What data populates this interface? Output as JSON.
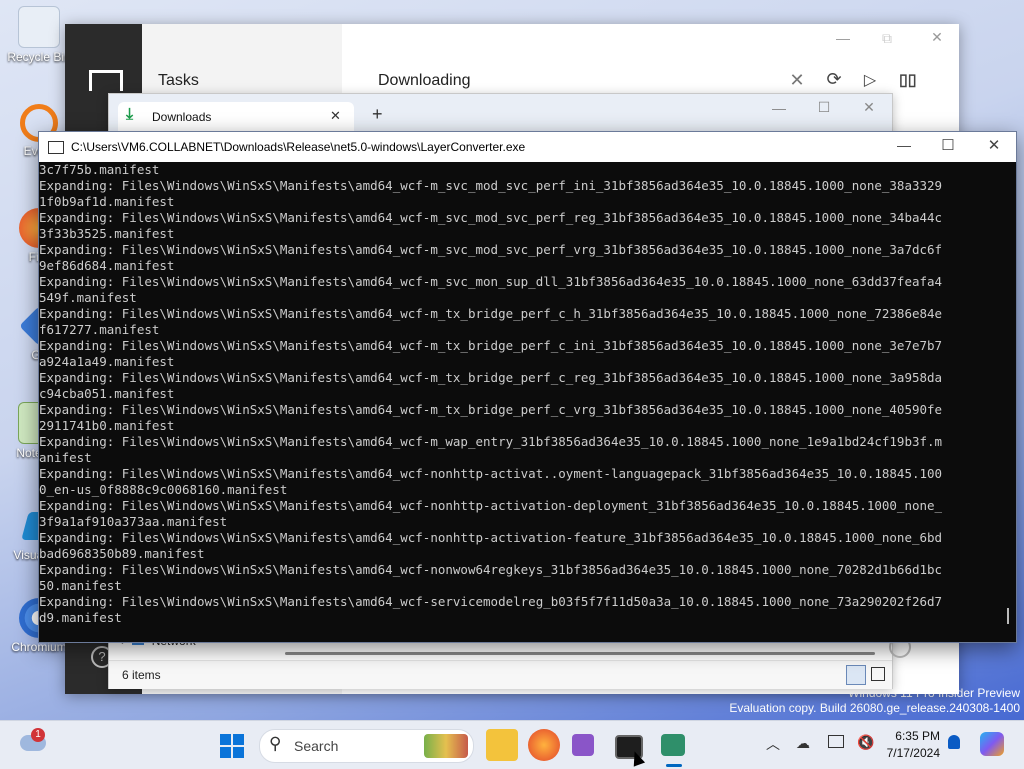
{
  "desktop": {
    "icons": [
      "Recycle Bin",
      "Every",
      "Fire",
      "Git",
      "Notepad",
      "Visual Co",
      "Chromium"
    ],
    "watermark": [
      "Windows 11 Pro Insider Preview",
      "Evaluation copy. Build 26080.ge_release.240308-1400"
    ]
  },
  "tasks_window": {
    "nav_title": "Tasks",
    "header": "Downloading"
  },
  "explorer": {
    "tab_label": "Downloads",
    "new_tab": "+",
    "nav_item": "Network",
    "status_items": "6 items"
  },
  "console": {
    "title": "C:\\Users\\VM6.COLLABNET\\Downloads\\Release\\net5.0-windows\\LayerConverter.exe",
    "lines": [
      "3c7f75b.manifest",
      "Expanding: Files\\Windows\\WinSxS\\Manifests\\amd64_wcf-m_svc_mod_svc_perf_ini_31bf3856ad364e35_10.0.18845.1000_none_38a3329",
      "1f0b9af1d.manifest",
      "Expanding: Files\\Windows\\WinSxS\\Manifests\\amd64_wcf-m_svc_mod_svc_perf_reg_31bf3856ad364e35_10.0.18845.1000_none_34ba44c",
      "3f33b3525.manifest",
      "Expanding: Files\\Windows\\WinSxS\\Manifests\\amd64_wcf-m_svc_mod_svc_perf_vrg_31bf3856ad364e35_10.0.18845.1000_none_3a7dc6f",
      "9ef86d684.manifest",
      "Expanding: Files\\Windows\\WinSxS\\Manifests\\amd64_wcf-m_svc_mon_sup_dll_31bf3856ad364e35_10.0.18845.1000_none_63dd37feafa4",
      "549f.manifest",
      "Expanding: Files\\Windows\\WinSxS\\Manifests\\amd64_wcf-m_tx_bridge_perf_c_h_31bf3856ad364e35_10.0.18845.1000_none_72386e84e",
      "f617277.manifest",
      "Expanding: Files\\Windows\\WinSxS\\Manifests\\amd64_wcf-m_tx_bridge_perf_c_ini_31bf3856ad364e35_10.0.18845.1000_none_3e7e7b7",
      "a924a1a49.manifest",
      "Expanding: Files\\Windows\\WinSxS\\Manifests\\amd64_wcf-m_tx_bridge_perf_c_reg_31bf3856ad364e35_10.0.18845.1000_none_3a958da",
      "c94cba051.manifest",
      "Expanding: Files\\Windows\\WinSxS\\Manifests\\amd64_wcf-m_tx_bridge_perf_c_vrg_31bf3856ad364e35_10.0.18845.1000_none_40590fe",
      "2911741b0.manifest",
      "Expanding: Files\\Windows\\WinSxS\\Manifests\\amd64_wcf-m_wap_entry_31bf3856ad364e35_10.0.18845.1000_none_1e9a1bd24cf19b3f.m",
      "anifest",
      "Expanding: Files\\Windows\\WinSxS\\Manifests\\amd64_wcf-nonhttp-activat..oyment-languagepack_31bf3856ad364e35_10.0.18845.100",
      "0_en-us_0f8888c9c0068160.manifest",
      "Expanding: Files\\Windows\\WinSxS\\Manifests\\amd64_wcf-nonhttp-activation-deployment_31bf3856ad364e35_10.0.18845.1000_none_",
      "3f9a1af910a373aa.manifest",
      "Expanding: Files\\Windows\\WinSxS\\Manifests\\amd64_wcf-nonhttp-activation-feature_31bf3856ad364e35_10.0.18845.1000_none_6bd",
      "bad6968350b89.manifest",
      "Expanding: Files\\Windows\\WinSxS\\Manifests\\amd64_wcf-nonwow64regkeys_31bf3856ad364e35_10.0.18845.1000_none_70282d1b66d1bc",
      "50.manifest",
      "Expanding: Files\\Windows\\WinSxS\\Manifests\\amd64_wcf-servicemodelreg_b03f5f7f11d50a3a_10.0.18845.1000_none_73a290202f26d7",
      "d9.manifest"
    ]
  },
  "taskbar": {
    "search_placeholder": "Search",
    "time": "6:35 PM",
    "date": "7/17/2024",
    "weather_badge": "1"
  },
  "colors": {
    "console_bg": "#0c0c0c",
    "console_fg": "#cccccc",
    "accent": "#0067c0"
  }
}
